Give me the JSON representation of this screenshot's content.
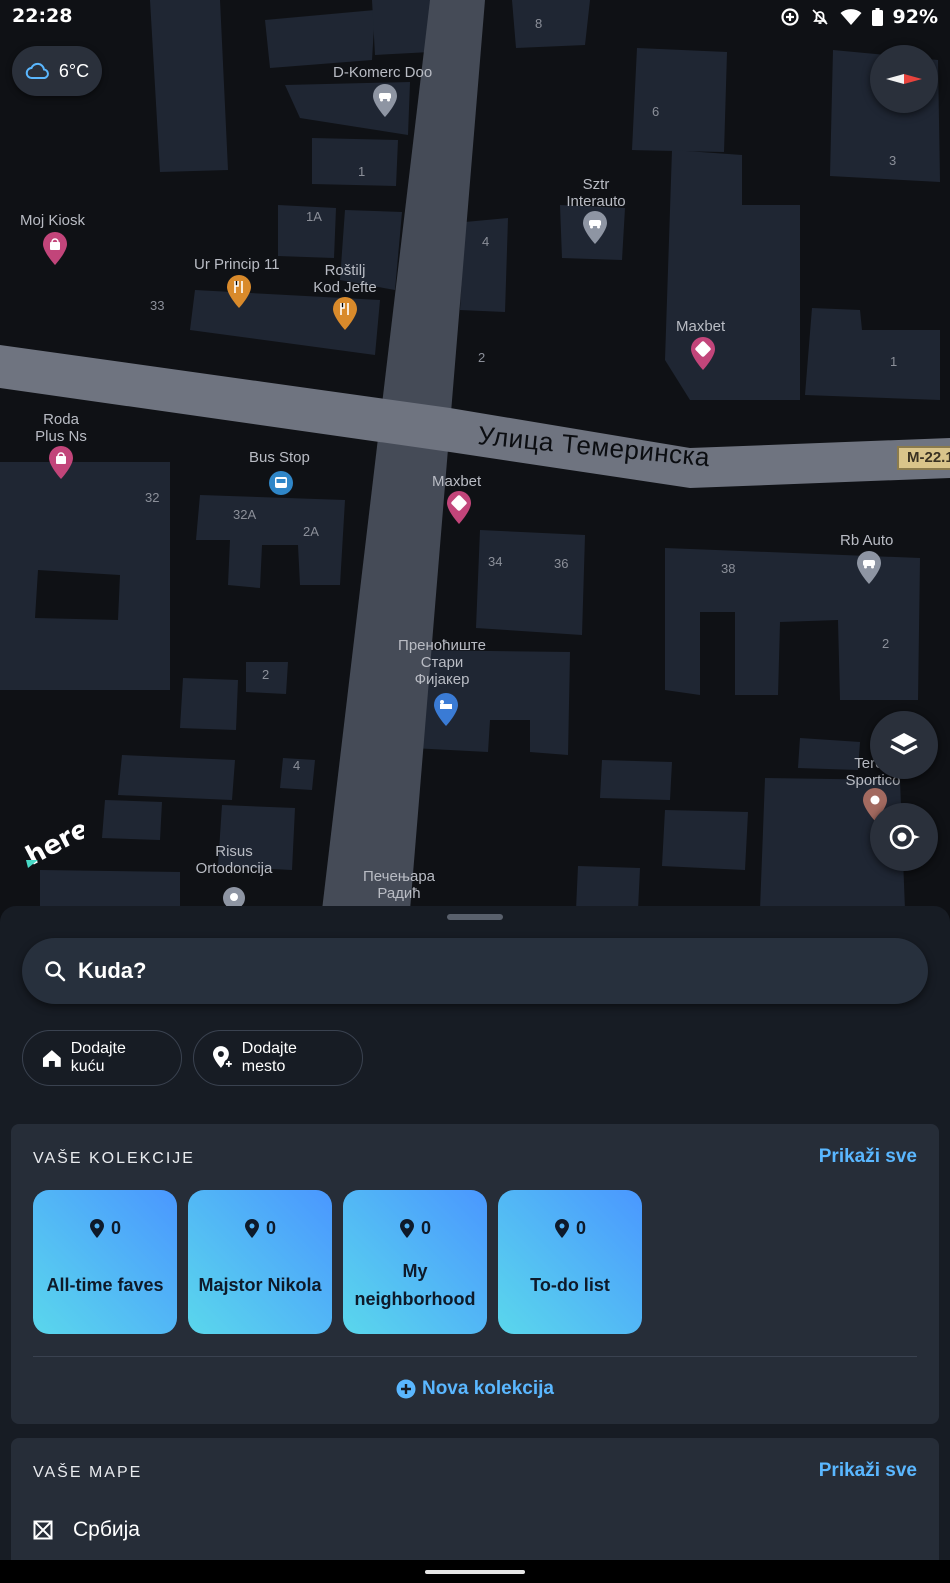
{
  "status_bar": {
    "time": "22:28",
    "battery": "92%",
    "icons": [
      "data-saver-icon",
      "notifications-off-icon",
      "wifi-icon",
      "battery-icon"
    ]
  },
  "map": {
    "weather": {
      "temperature": "6°C",
      "icon": "cloud-icon"
    },
    "street_name": "Улица Темеринска",
    "road_shield": "M-22.1",
    "places": [
      {
        "name": "D-Komerc Doo",
        "category": "car-service"
      },
      {
        "name": "Sztr Interauto",
        "category": "car-service"
      },
      {
        "name": "Moj Kiosk",
        "category": "shopping"
      },
      {
        "name": "Ur Princip 11",
        "category": "restaurant"
      },
      {
        "name": "Roštilj Kod Jefte",
        "category": "restaurant"
      },
      {
        "name": "Maxbet",
        "category": "betting"
      },
      {
        "name": "Roda Plus Ns",
        "category": "shopping"
      },
      {
        "name": "Bus Stop",
        "category": "bus"
      },
      {
        "name": "Maxbet",
        "category": "betting"
      },
      {
        "name": "Rb Auto",
        "category": "car-service"
      },
      {
        "name": "Преноћиште Стари Фијакер",
        "category": "hotel"
      },
      {
        "name": "Teren Sportico",
        "category": "sport"
      },
      {
        "name": "Risus Ortodoncija",
        "category": "health"
      },
      {
        "name": "Печењара Радић",
        "category": "restaurant"
      }
    ],
    "house_numbers": [
      "8",
      "6",
      "3",
      "1",
      "1A",
      "4",
      "33",
      "2",
      "1",
      "32",
      "32A",
      "2A",
      "34",
      "36",
      "38",
      "2",
      "2",
      "4"
    ],
    "brand": "here",
    "colors": {
      "poi_pink": "#c2457a",
      "poi_orange": "#d98a2b",
      "poi_gray": "#8e95a3",
      "poi_blue": "#3a7bd5",
      "poi_bus": "#2f86c8"
    }
  },
  "sheet": {
    "search_placeholder": "Kuda?",
    "chips": [
      {
        "label": "Dodajte kuću",
        "icon": "home-icon"
      },
      {
        "label": "Dodajte mesto",
        "icon": "add-place-icon"
      }
    ],
    "collections": {
      "title": "VAŠE KOLEKCIJE",
      "show_all": "Prikaži sve",
      "items": [
        {
          "name": "All-time faves",
          "count": "0"
        },
        {
          "name": "Majstor Nikola",
          "count": "0"
        },
        {
          "name": "My neighborhood",
          "count": "0"
        },
        {
          "name": "To-do list",
          "count": "0"
        }
      ],
      "new_label": "Nova kolekcija"
    },
    "maps": {
      "title": "VAŠE MAPE",
      "show_all": "Prikaži sve",
      "items": [
        {
          "name": "Србија"
        }
      ]
    }
  },
  "accent_color": "#5ab7ff"
}
